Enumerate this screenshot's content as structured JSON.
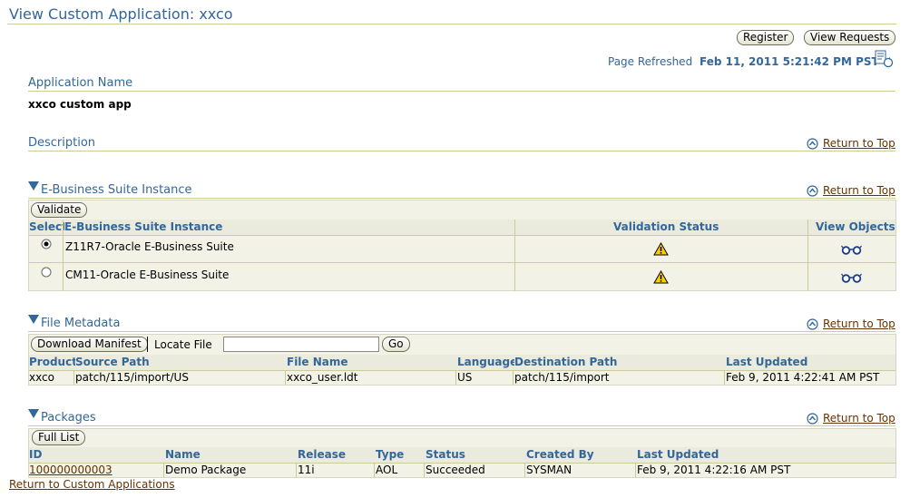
{
  "page": {
    "title": "View Custom Application: xxco",
    "register_label": "Register",
    "view_requests_label": "View Requests",
    "refresh_label": "Page Refreshed",
    "refresh_value": "Feb 11, 2011 5:21:42 PM PST"
  },
  "app_name": {
    "label": "Application Name",
    "value": "xxco custom app"
  },
  "description": {
    "label": "Description"
  },
  "return_to_top": "Return to Top",
  "ebs": {
    "title": "E-Business Suite Instance",
    "validate_label": "Validate",
    "headers": [
      "Select",
      "E-Business Suite Instance",
      "Validation Status",
      "View Objects"
    ],
    "rows": [
      {
        "selected": true,
        "instance": "Z11R7-Oracle E-Business Suite",
        "status_icon": "warning-icon",
        "view_icon": "glasses-icon"
      },
      {
        "selected": false,
        "instance": "CM11-Oracle E-Business Suite",
        "status_icon": "warning-icon",
        "view_icon": "glasses-icon"
      }
    ]
  },
  "file_metadata": {
    "title": "File Metadata",
    "download_label": "Download Manifest",
    "locate_label": "Locate File",
    "locate_value": "",
    "go_label": "Go",
    "headers": [
      "Product",
      "Source Path",
      "File Name",
      "Language",
      "Destination Path",
      "Last Updated"
    ],
    "rows": [
      {
        "product": "xxco",
        "source_path": "patch/115/import/US",
        "file_name": "xxco_user.ldt",
        "language": "US",
        "destination_path": "patch/115/import",
        "last_updated": "Feb 9, 2011 4:22:41 AM PST"
      }
    ]
  },
  "packages": {
    "title": "Packages",
    "full_list_label": "Full List",
    "headers": [
      "ID",
      "Name",
      "Release",
      "Type",
      "Status",
      "Created By",
      "Last Updated"
    ],
    "rows": [
      {
        "id": "100000000003",
        "name": "Demo Package",
        "release": "11i",
        "type": "AOL",
        "status": "Succeeded",
        "created_by": "SYSMAN",
        "last_updated": "Feb 9, 2011 4:22:16 AM PST"
      }
    ]
  },
  "footer": {
    "return_link": "Return to Custom Applications"
  },
  "colors": {
    "header_blue": "#336699",
    "link_brown": "#663300",
    "rule": "#cccc99",
    "panel": "#f2f2e6"
  }
}
